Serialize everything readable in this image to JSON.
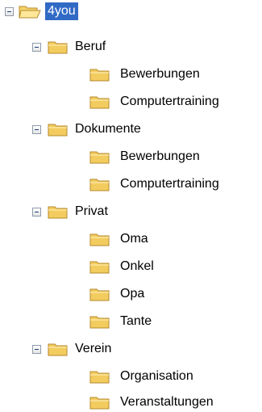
{
  "tree": {
    "root": {
      "label": "4you",
      "selected": true
    },
    "groups": [
      {
        "label": "Beruf",
        "children": [
          "Bewerbungen",
          "Computertraining"
        ]
      },
      {
        "label": "Dokumente",
        "children": [
          "Bewerbungen",
          "Computertraining"
        ]
      },
      {
        "label": "Privat",
        "children": [
          "Oma",
          "Onkel",
          "Opa",
          "Tante"
        ]
      },
      {
        "label": "Verein",
        "children": [
          "Organisation",
          "Veranstaltungen"
        ]
      }
    ]
  },
  "icons": {
    "collapse": "collapse-minus-icon",
    "folder_open": "folder-open-icon",
    "folder_closed": "folder-icon"
  },
  "colors": {
    "selection": "#316ac5",
    "folder": "#f5d36b"
  }
}
